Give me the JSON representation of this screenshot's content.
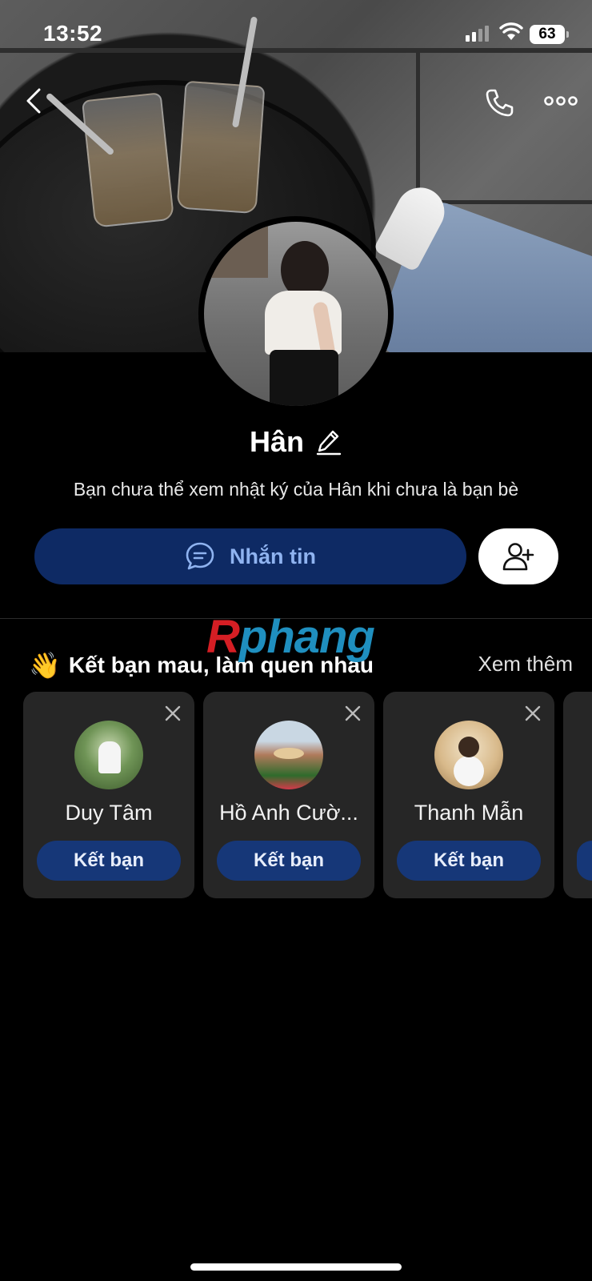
{
  "status_bar": {
    "time": "13:52",
    "battery": "63"
  },
  "nav": {
    "back_icon": "chevron-left-icon",
    "call_icon": "phone-icon",
    "more_icon": "more-horizontal-icon"
  },
  "profile": {
    "name": "Hân",
    "notice": "Bạn chưa thể xem nhật ký của Hân khi chưa là bạn bè",
    "message_button_label": "Nhắn tin",
    "add_friend_icon": "add-user-icon"
  },
  "watermark": {
    "first": "R",
    "rest": "phang"
  },
  "suggestions": {
    "emoji": "👋",
    "title": "Kết bạn mau, làm quen nhau",
    "see_more": "Xem thêm",
    "items": [
      {
        "name": "Duy Tâm",
        "button": "Kết bạn"
      },
      {
        "name": "Hồ Anh Cườ...",
        "button": "Kết bạn"
      },
      {
        "name": "Thanh Mẫn",
        "button": "Kết bạn"
      }
    ]
  },
  "colors": {
    "background": "#000000",
    "primary_button": "#0e2a64",
    "primary_button_text": "#8fb3f0",
    "card_background": "#262626",
    "card_button": "#163778"
  }
}
